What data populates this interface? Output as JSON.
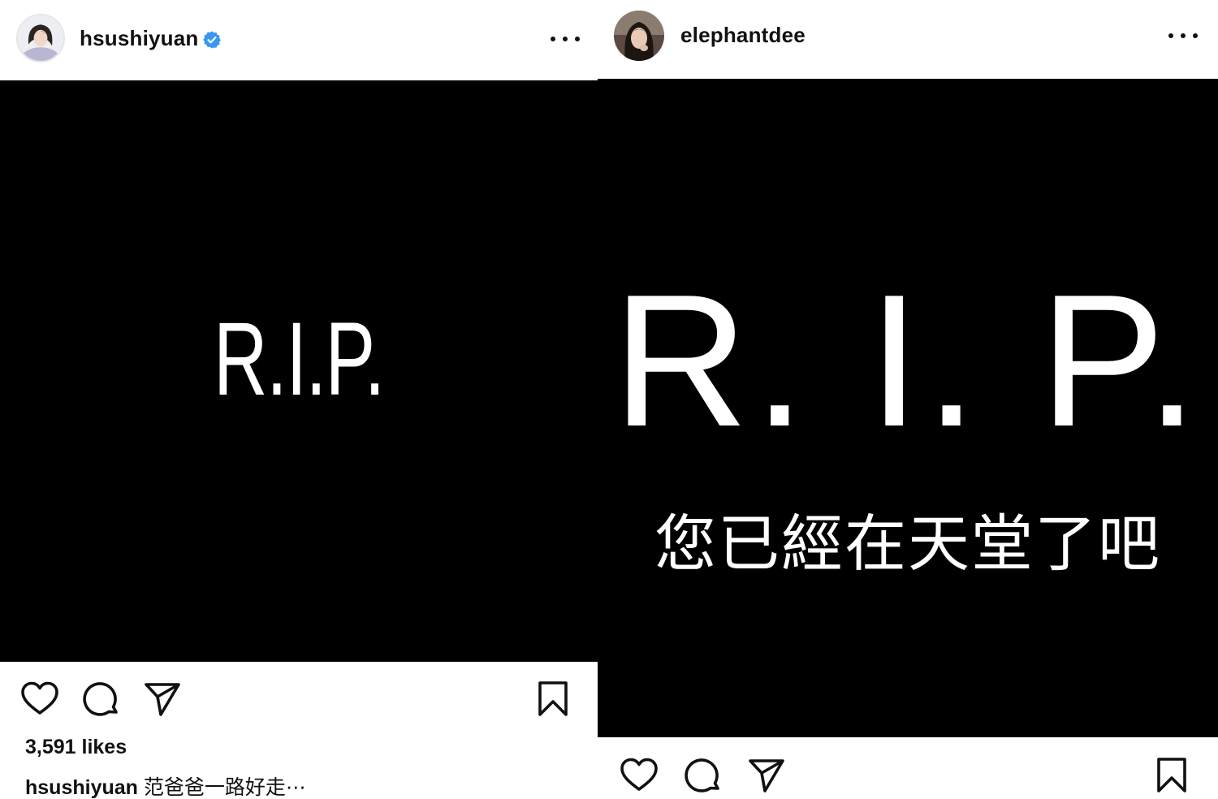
{
  "left_post": {
    "username": "hsushiyuan",
    "verified": true,
    "image_text": "R.I.P.",
    "likes": "3,591 likes",
    "caption_user": "hsushiyuan",
    "caption_text": "范爸爸一路好走⋯",
    "icons": {
      "avatar": "profile-avatar",
      "verified": "verified-badge-icon",
      "more": "more-options-icon",
      "like": "heart-icon",
      "comment": "comment-icon",
      "share": "send-icon",
      "save": "bookmark-icon"
    }
  },
  "right_post": {
    "username": "elephantdee",
    "verified": false,
    "image_text": "R. I. P.",
    "image_subtext": "您已經在天堂了吧",
    "icons": {
      "avatar": "profile-avatar",
      "more": "more-options-icon",
      "like": "heart-icon",
      "comment": "comment-icon",
      "share": "send-icon",
      "save": "bookmark-icon"
    }
  },
  "colors": {
    "verified_blue": "#3897f0",
    "image_background": "#000000",
    "text": "#111111"
  }
}
